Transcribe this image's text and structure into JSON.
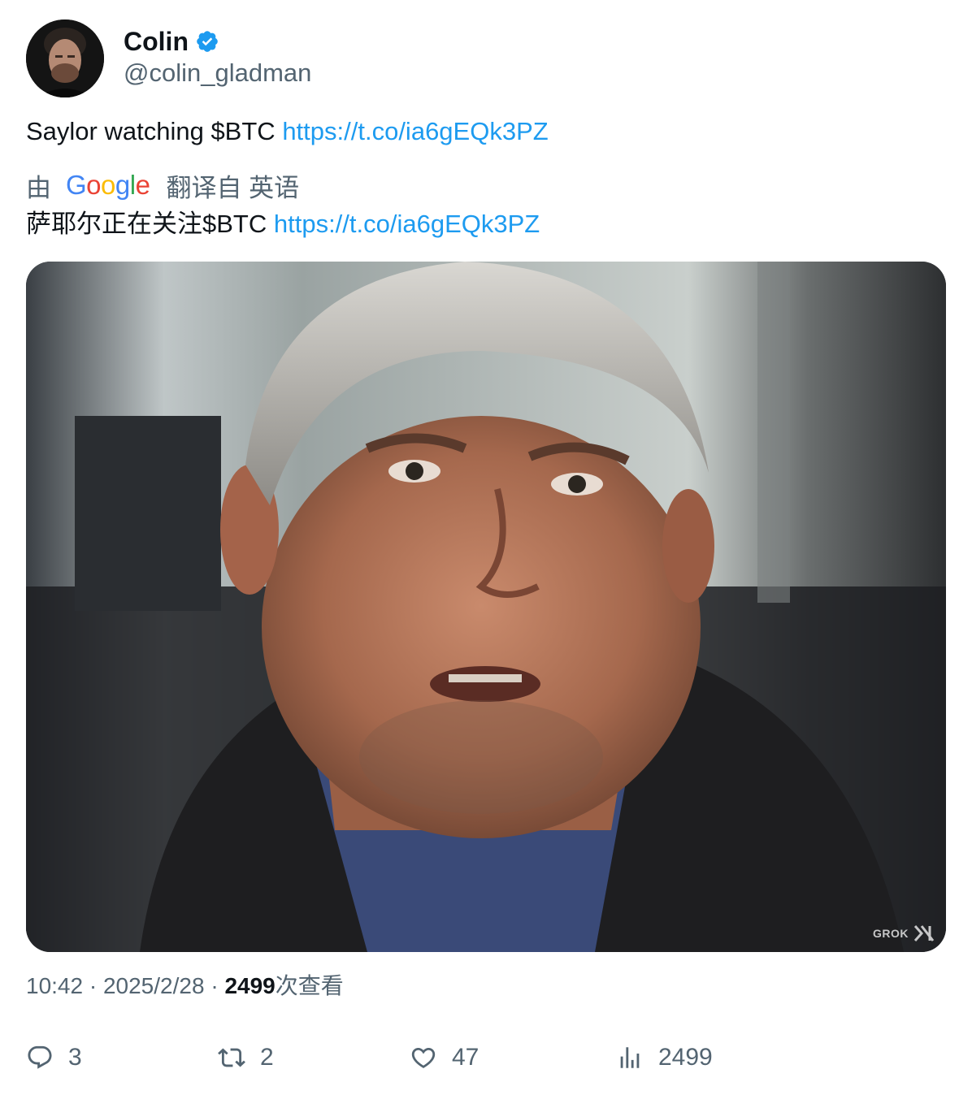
{
  "author": {
    "display_name": "Colin",
    "handle": "@colin_gladman",
    "verified_icon": "verified-badge-icon",
    "badge_color": "#1d9bf0"
  },
  "tweet": {
    "text": "Saylor watching $BTC ",
    "link": "https://t.co/ia6gEQk3PZ"
  },
  "translation": {
    "prefix": "由",
    "provider": "Google",
    "suffix": "翻译自 英语",
    "text": "萨耶尔正在关注$BTC ",
    "link": "https://t.co/ia6gEQk3PZ"
  },
  "media": {
    "watermark": "GROK"
  },
  "meta": {
    "time": "10:42",
    "separator": " · ",
    "date": "2025/2/28",
    "views_count": "2499",
    "views_label": "次查看"
  },
  "actions": {
    "replies": "3",
    "reposts": "2",
    "likes": "47",
    "views": "2499"
  },
  "colors": {
    "link": "#1d9bf0",
    "secondary_text": "#536471",
    "primary_text": "#0f1419"
  }
}
